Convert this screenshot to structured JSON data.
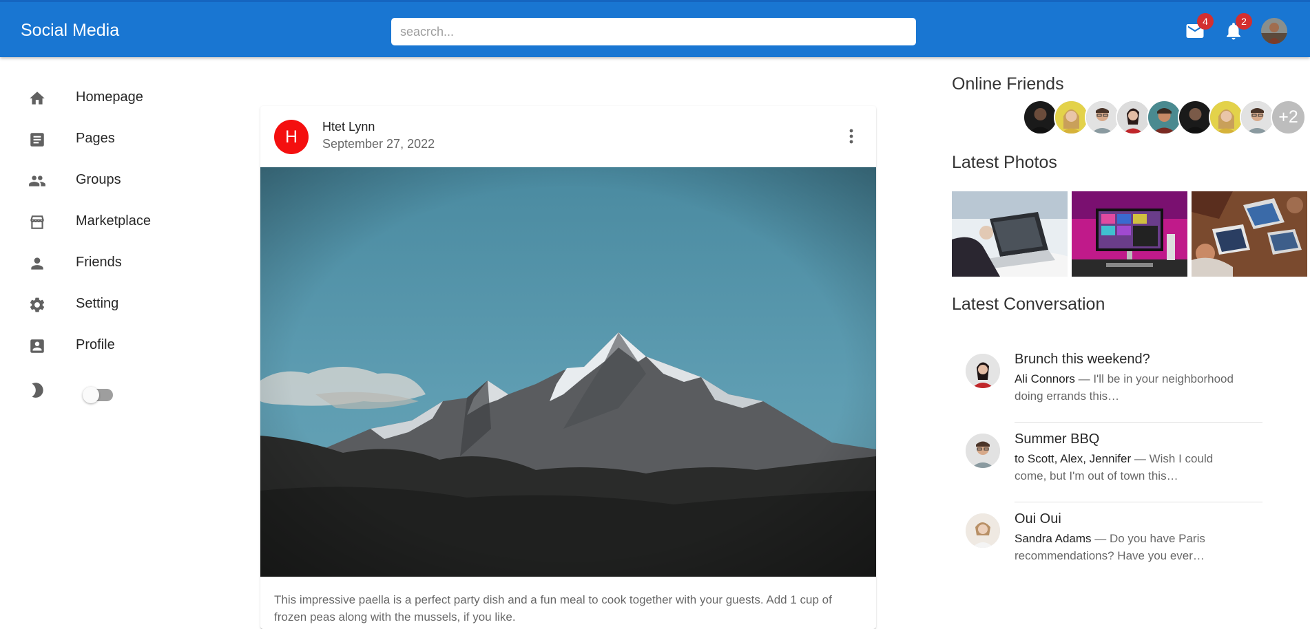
{
  "header": {
    "brand": "Social Media",
    "search_placeholder": "seacrch...",
    "mail_count": "4",
    "notification_count": "2"
  },
  "sidebar": {
    "items": [
      {
        "label": "Homepage",
        "icon": "home-icon"
      },
      {
        "label": "Pages",
        "icon": "article-icon"
      },
      {
        "label": "Groups",
        "icon": "groups-icon"
      },
      {
        "label": "Marketplace",
        "icon": "storefront-icon"
      },
      {
        "label": "Friends",
        "icon": "person-icon"
      },
      {
        "label": "Setting",
        "icon": "settings-icon"
      },
      {
        "label": "Profile",
        "icon": "account-box-icon"
      }
    ],
    "dark_mode_on": false
  },
  "post": {
    "avatar_letter": "H",
    "author": "Htet Lynn",
    "date": "September 27, 2022",
    "text": "This impressive paella is a perfect party dish and a fun meal to cook together with your guests. Add 1 cup of frozen peas along with the mussels, if you like."
  },
  "right_panel": {
    "online_friends_title": "Online Friends",
    "online_friends_extra": "+2",
    "latest_photos_title": "Latest Photos",
    "latest_conversation_title": "Latest Conversation",
    "conversations": [
      {
        "title": "Brunch this weekend?",
        "from": "Ali Connors",
        "snippet_line1": " — I'll be in your neighborhood",
        "snippet_line2": "doing errands this…"
      },
      {
        "title": "Summer BBQ",
        "from": "to Scott, Alex, Jennifer",
        "snippet_line1": " — Wish I could",
        "snippet_line2": "come, but I'm out of town this…"
      },
      {
        "title": "Oui Oui",
        "from": "Sandra Adams",
        "snippet_line1": " — Do you have Paris",
        "snippet_line2": "recommendations? Have you ever…"
      }
    ]
  },
  "colors": {
    "appbar": "#1976d2",
    "badge": "#d32f2f",
    "post_avatar": "#f40f0f"
  }
}
